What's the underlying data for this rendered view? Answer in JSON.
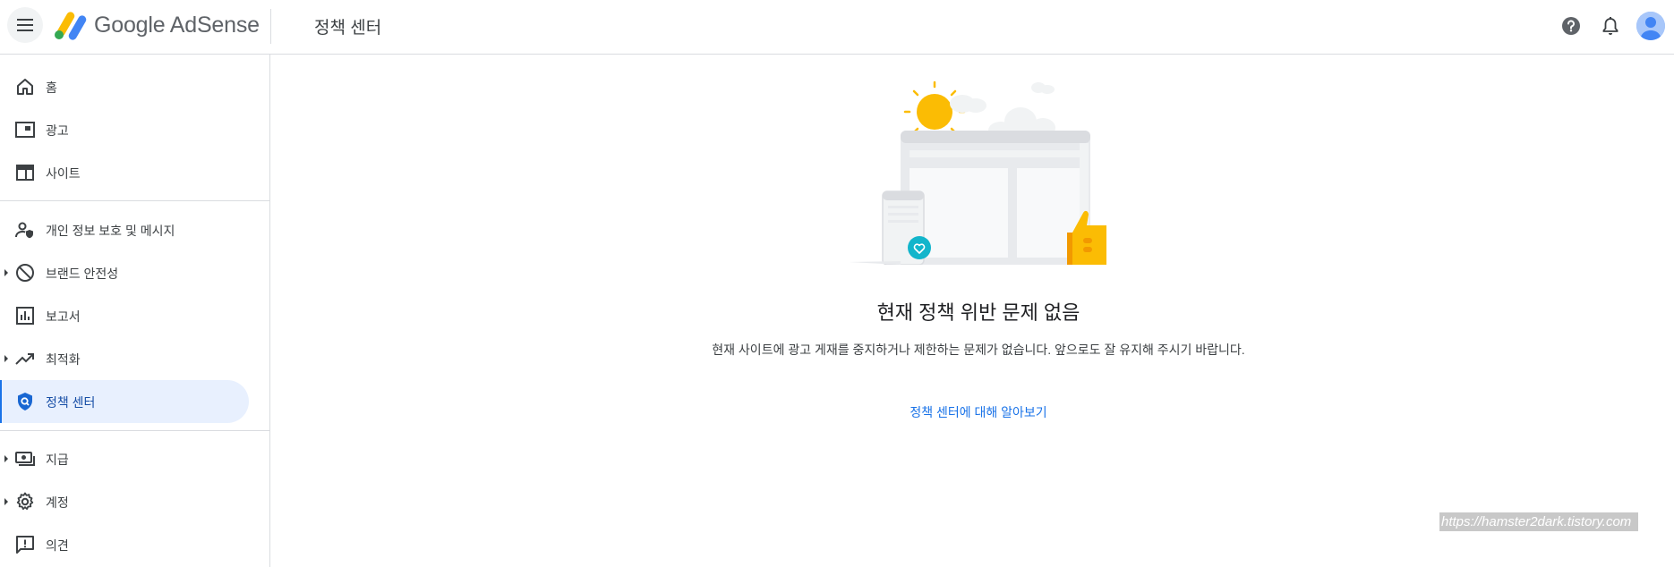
{
  "header": {
    "brand": "Google AdSense",
    "page_title": "정책 센터"
  },
  "sidebar": {
    "items": [
      {
        "label": "홈"
      },
      {
        "label": "광고"
      },
      {
        "label": "사이트"
      },
      {
        "label": "개인 정보 보호 및 메시지"
      },
      {
        "label": "브랜드 안전성"
      },
      {
        "label": "보고서"
      },
      {
        "label": "최적화"
      },
      {
        "label": "정책 센터"
      },
      {
        "label": "지급"
      },
      {
        "label": "계정"
      },
      {
        "label": "의견"
      }
    ]
  },
  "main": {
    "title": "현재 정책 위반 문제 없음",
    "description": "현재 사이트에 광고 게재를 중지하거나 제한하는 문제가 없습니다. 앞으로도 잘 유지해 주시기 바랍니다.",
    "learn_more_link": "정책 센터에 대해 알아보기"
  },
  "watermark": "https://hamster2dark.tistory.com",
  "colors": {
    "accent": "#1a73e8",
    "active_bg": "#e8f0fe",
    "sun": "#fbbc04",
    "teal_badge": "#12b5cb"
  }
}
